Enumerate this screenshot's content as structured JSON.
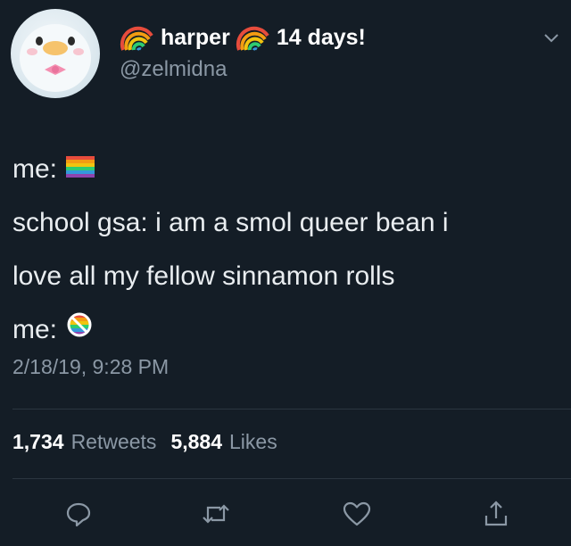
{
  "user": {
    "display_name": "harper",
    "name_suffix": "14 days!",
    "handle": "@zelmidna",
    "badge_icon": "rainbow-icon"
  },
  "tweet": {
    "lines": [
      {
        "text": "me:",
        "emoji": "rainbow-flag-icon"
      },
      {
        "text": "school gsa: i am a smol queer bean i"
      },
      {
        "text": "love all my fellow sinnamon rolls"
      },
      {
        "text": "me:",
        "emoji": "no-rainbow-icon"
      }
    ],
    "timestamp": "2/18/19, 9:28 PM"
  },
  "stats": {
    "retweets_count": "1,734",
    "retweets_label": "Retweets",
    "likes_count": "5,884",
    "likes_label": "Likes"
  },
  "actions": [
    "reply-icon",
    "retweet-icon",
    "like-icon",
    "share-icon"
  ],
  "colors": {
    "background": "#141d26",
    "text": "#e9edf0",
    "muted": "#8b98a5"
  }
}
